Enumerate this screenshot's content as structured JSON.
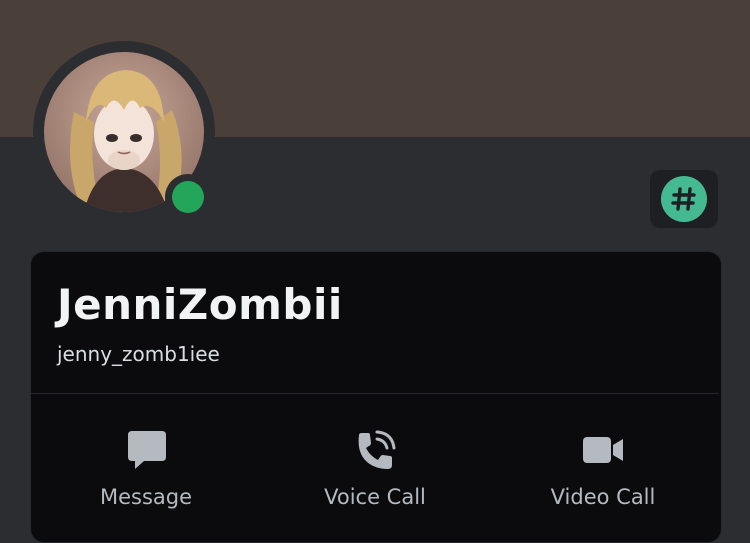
{
  "profile": {
    "display_name": "JenniZombii",
    "username": "jenny_zomb1iee",
    "status": "online",
    "banner_color": "#4b4039",
    "status_color": "#23a55a"
  },
  "badge": {
    "glyph": "#",
    "icon": "hashtag-badge-icon",
    "color": "#45ba92"
  },
  "actions": [
    {
      "label": "Message",
      "icon": "message-icon"
    },
    {
      "label": "Voice Call",
      "icon": "phone-icon"
    },
    {
      "label": "Video Call",
      "icon": "video-camera-icon"
    }
  ]
}
